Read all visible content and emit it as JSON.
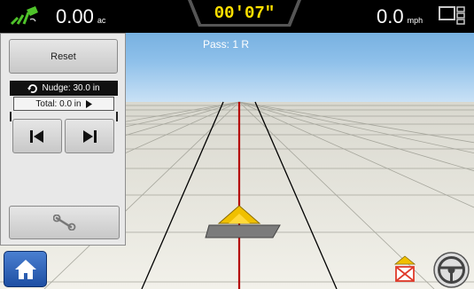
{
  "status_bar": {
    "area_value": "0.00",
    "area_unit": "ac",
    "timer": "00'07\"",
    "speed_value": "0.0",
    "speed_unit": "mph"
  },
  "guidance": {
    "pass_label": "Pass: 1 R"
  },
  "nudge_panel": {
    "reset_label": "Reset",
    "nudge_label": "Nudge: 30.0 in",
    "total_label": "Total: 0.0 in"
  },
  "icons": {
    "gps": "gps-signal-icon",
    "layout": "display-layout-icon",
    "refresh": "refresh-icon",
    "nudge_left": "nudge-left-icon",
    "nudge_right": "nudge-right-icon",
    "wrench": "wrench-icon",
    "home": "home-icon",
    "implement_off": "implement-off-icon",
    "steering": "steering-wheel-icon"
  },
  "colors": {
    "guidance_line": "#b40000",
    "tractor": "#f0c000",
    "timer_text": "#ffe000",
    "home_button": "#2a5fb8",
    "status_off": "#e03a2a"
  }
}
